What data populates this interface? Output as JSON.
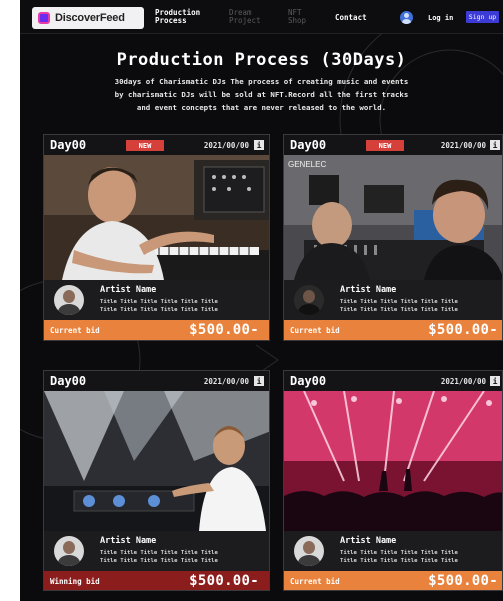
{
  "header": {
    "logo_text": "DiscoverFeed",
    "nav": [
      {
        "line1": "Production",
        "line2": "Process"
      },
      {
        "line1": "Dream",
        "line2": "Project"
      },
      {
        "line1": "NFT",
        "line2": "Shop"
      },
      {
        "line1": "Contact",
        "line2": ""
      }
    ],
    "login_label": "Log in",
    "signup_label": "Sign up"
  },
  "title": "Production Process (30Days)",
  "intro": [
    "30days of Charismatic DJs The process of creating music and events",
    "by charismatic DJs will be sold at NFT.Record all the first tracks",
    "and event concepts that are never released to the world."
  ],
  "cards": [
    {
      "day": "Day00",
      "badge": "NEW",
      "date": "2021/00/00",
      "info": "i",
      "artist_name": "Artist Name",
      "titles": [
        "Title Title Title Title Title Title",
        "Title Title Title Title Title Title"
      ],
      "bid_label": "Current bid",
      "bid_value": "$500.00-"
    },
    {
      "day": "Day00",
      "badge": "NEW",
      "date": "2021/00/00",
      "info": "i",
      "photo_text": "GENELEC",
      "artist_name": "Artist Name",
      "titles": [
        "Title Title Title Title Title Title",
        "Title Title Title Title Title Title"
      ],
      "bid_label": "Current bid",
      "bid_value": "$500.00-"
    },
    {
      "day": "Day00",
      "badge": "",
      "date": "2021/00/00",
      "info": "i",
      "artist_name": "Artist Name",
      "titles": [
        "Title Title Title Title Title Title",
        "Title Title Title Title Title Title"
      ],
      "bid_label": "Winning bid",
      "bid_value": "$500.00-"
    },
    {
      "day": "Day00",
      "badge": "",
      "date": "2021/00/00",
      "info": "i",
      "artist_name": "Artist Name",
      "titles": [
        "Title Title Title Title Title Title",
        "Title Title Title Title Title Title"
      ],
      "bid_label": "Current bid",
      "bid_value": "$500.00-"
    }
  ],
  "colors": {
    "background": "#0b0b0d",
    "current_bid": "#e8823d",
    "winning_bid": "#8b1d1d",
    "new_badge": "#d6403a",
    "signup": "#3c3bd6",
    "logo_mark": "#6b2cf0"
  },
  "icons": {
    "logo": "discoverfeed-logo-icon",
    "user": "user-icon",
    "info": "info-icon"
  }
}
